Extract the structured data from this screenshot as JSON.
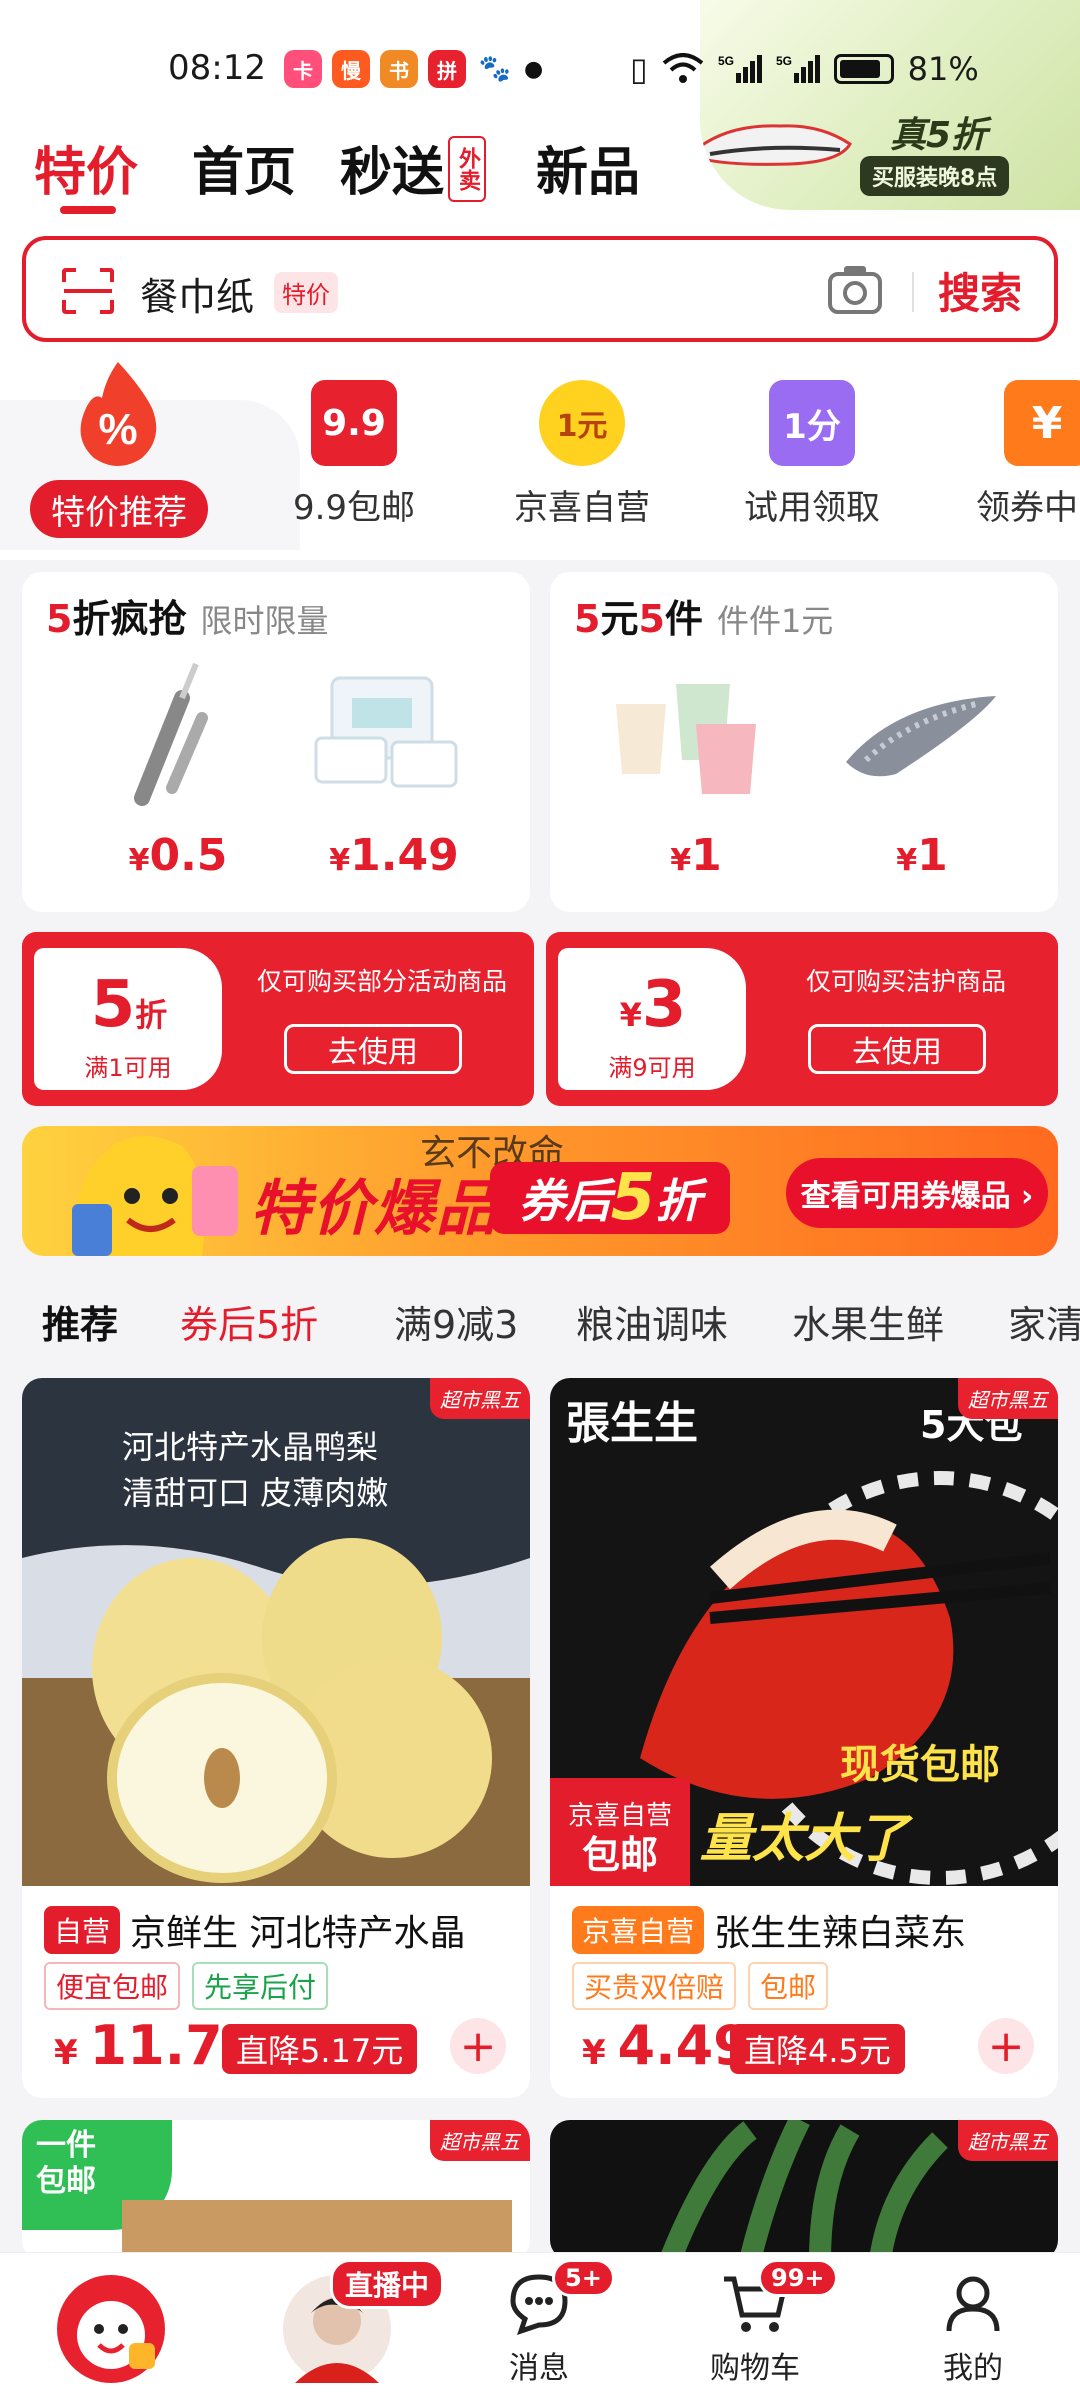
{
  "status_bar": {
    "time": "08:12",
    "app_icons": [
      {
        "name": "app-icon-1",
        "color": "#ff4f7a",
        "glyph": "卡"
      },
      {
        "name": "app-icon-2",
        "color": "#ff5a1f",
        "glyph": "慢"
      },
      {
        "name": "app-icon-3",
        "color": "#f08a24",
        "glyph": "书"
      },
      {
        "name": "app-icon-4",
        "color": "#e8212f",
        "glyph": "拼"
      },
      {
        "name": "baidu-icon",
        "color": "#2f6ff0",
        "glyph": "du"
      }
    ],
    "network": "5G",
    "battery": "81%"
  },
  "promo_corner": {
    "headline": "真5折",
    "tag": "买服装晚8点"
  },
  "nav_tabs": [
    {
      "label": "特价",
      "active": true
    },
    {
      "label": "首页",
      "active": false
    },
    {
      "label": "秒送",
      "active": false,
      "badge": "外卖"
    },
    {
      "label": "新品",
      "active": false
    }
  ],
  "search": {
    "value": "餐巾纸",
    "tag": "特价",
    "button": "搜索"
  },
  "categories": [
    {
      "label": "特价推荐",
      "active": true,
      "icon": "discount-fire-icon"
    },
    {
      "label": "9.9包邮",
      "icon_text": "9.9",
      "icon_color": "#e8212f"
    },
    {
      "label": "京喜自营",
      "icon_text": "1元",
      "icon_color": "#ffd21f"
    },
    {
      "label": "试用领取",
      "icon_text": "1分",
      "icon_color": "#9a6cf2"
    },
    {
      "label": "领券中",
      "icon_text": "¥",
      "icon_color": "#ff7a1a"
    }
  ],
  "deals": [
    {
      "title_red": "5",
      "title": "折疯抢",
      "subtitle": "限时限量",
      "items": [
        {
          "price": "0.5",
          "name": "pen-item"
        },
        {
          "price": "1.49",
          "name": "tissue-item"
        }
      ]
    },
    {
      "title_red": "5",
      "title_mid": "元",
      "title_red2": "5",
      "title": "件",
      "subtitle": "件件1元",
      "items": [
        {
          "price": "1",
          "name": "cups-item"
        },
        {
          "price": "1",
          "name": "hairclip-item"
        }
      ]
    }
  ],
  "coupons": [
    {
      "value": "5",
      "unit": "折",
      "condition": "满1可用",
      "desc": "仅可购买部分活动商品",
      "button": "去使用"
    },
    {
      "prefix": "¥",
      "value": "3",
      "condition": "满9可用",
      "desc": "仅可购买洁护商品",
      "button": "去使用"
    }
  ],
  "banner": {
    "slogan": "玄不改命",
    "title": "特价爆品",
    "coupon_text": "券后",
    "coupon_value": "5",
    "coupon_unit": "折",
    "button": "查看可用券爆品 ›"
  },
  "filter_tabs": [
    {
      "label": "推荐",
      "style": "bold"
    },
    {
      "label": "券后5折",
      "style": "red"
    },
    {
      "label": "满9减3"
    },
    {
      "label": "粮油调味"
    },
    {
      "label": "水果生鲜"
    },
    {
      "label": "家清"
    }
  ],
  "products": [
    {
      "corner_tag": "超市黑五",
      "image_caption": [
        "河北特产水晶鸭梨",
        "清甜可口 皮薄肉嫩"
      ],
      "badge": "自营",
      "badge_color": "#e31d2c",
      "name": "京鲜生 河北特产水晶",
      "labels": [
        {
          "text": "便宜包邮",
          "color": "#e31d2c"
        },
        {
          "text": "先享后付",
          "color": "#1aa34a"
        }
      ],
      "price": "11.73",
      "drop": "直降5.17元"
    },
    {
      "corner_tag": "超市黑五",
      "image_caption": [
        "張生生",
        "5大包",
        "现货包邮",
        "量太大了"
      ],
      "image_badge": [
        "京喜自营",
        "包邮"
      ],
      "badge": "京喜自营",
      "badge_color": "#ff7a1a",
      "name": "张生生辣白菜东",
      "labels": [
        {
          "text": "买贵双倍赔",
          "color": "#ff7a1a"
        },
        {
          "text": "包邮",
          "color": "#ff7a1a"
        }
      ],
      "price": "4.49",
      "drop": "直降4.5元"
    },
    {
      "corner_tag": "超市黑五",
      "badge_text": [
        "一件",
        "包邮"
      ]
    },
    {
      "corner_tag": "超市黑五"
    }
  ],
  "bottom_nav": [
    {
      "label": "",
      "name": "jd-home-tab"
    },
    {
      "label": "直播中",
      "name": "live-tab"
    },
    {
      "label": "消息",
      "badge": "5+"
    },
    {
      "label": "购物车",
      "badge": "99+"
    },
    {
      "label": "我的"
    }
  ],
  "colors": {
    "accent": "#e31d2c",
    "background": "#f4f4f6"
  }
}
